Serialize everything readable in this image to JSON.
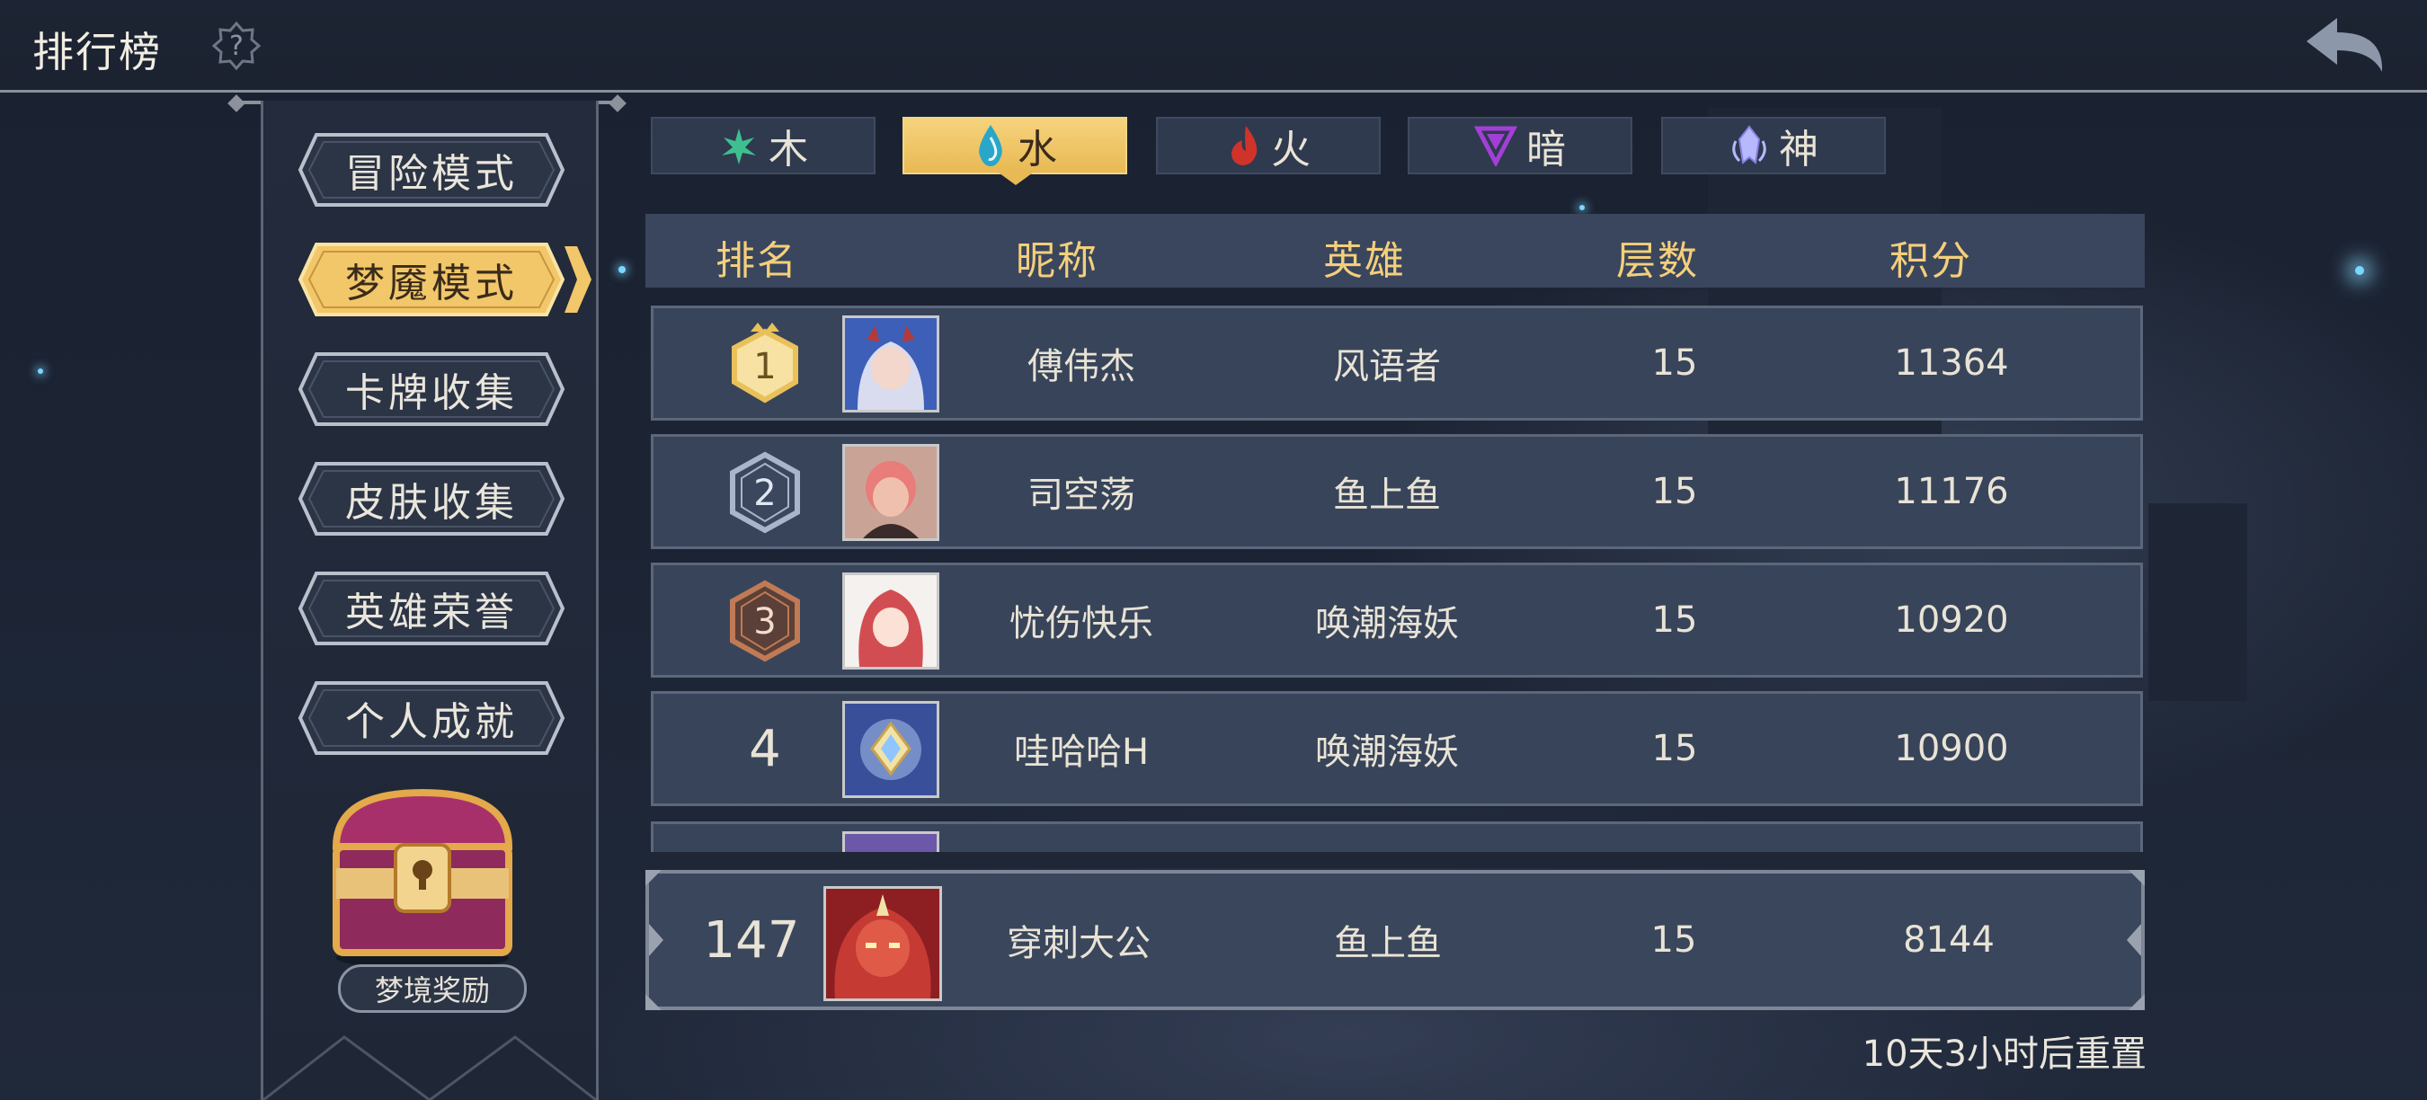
{
  "header": {
    "title": "排行榜",
    "help_icon": "question-icon",
    "back_icon": "back-arrow-icon"
  },
  "modes": [
    {
      "label": "冒险模式",
      "active": false
    },
    {
      "label": "梦魇模式",
      "active": true
    },
    {
      "label": "卡牌收集",
      "active": false
    },
    {
      "label": "皮肤收集",
      "active": false
    },
    {
      "label": "英雄荣誉",
      "active": false
    },
    {
      "label": "个人成就",
      "active": false
    }
  ],
  "reward": {
    "label": "梦境奖励"
  },
  "tabs": [
    {
      "label": "木",
      "icon": "leaf-icon",
      "color": "#3fbf8f",
      "active": false
    },
    {
      "label": "水",
      "icon": "water-drop-icon",
      "color": "#2aa6c9",
      "active": true
    },
    {
      "label": "火",
      "icon": "fire-icon",
      "color": "#d0332a",
      "active": false
    },
    {
      "label": "暗",
      "icon": "dark-triangle-icon",
      "color": "#a33fd6",
      "active": false
    },
    {
      "label": "神",
      "icon": "divine-crystal-icon",
      "color": "#b7b9ff",
      "active": false
    }
  ],
  "table": {
    "headers": [
      "排名",
      "昵称",
      "英雄",
      "层数",
      "积分"
    ],
    "rows": [
      {
        "rank": "1",
        "name": "傅伟杰",
        "hero": "风语者",
        "floor": "15",
        "score": "11364"
      },
      {
        "rank": "2",
        "name": "司空荡",
        "hero": "鱼上鱼",
        "floor": "15",
        "score": "11176"
      },
      {
        "rank": "3",
        "name": "忧伤快乐",
        "hero": "唤潮海妖",
        "floor": "15",
        "score": "10920"
      },
      {
        "rank": "4",
        "name": "哇哈哈H",
        "hero": "唤潮海妖",
        "floor": "15",
        "score": "10900"
      }
    ]
  },
  "my_rank": {
    "rank": "147",
    "name": "穿刺大公",
    "hero": "鱼上鱼",
    "floor": "15",
    "score": "8144"
  },
  "reset_text": "10天3小时后重置",
  "colors": {
    "gold": "#f4cf7b",
    "row_bg": "#38445a",
    "badge_gold": "#e9c15a",
    "badge_silver": "#a8b6cc",
    "badge_bronze": "#c07a55"
  }
}
